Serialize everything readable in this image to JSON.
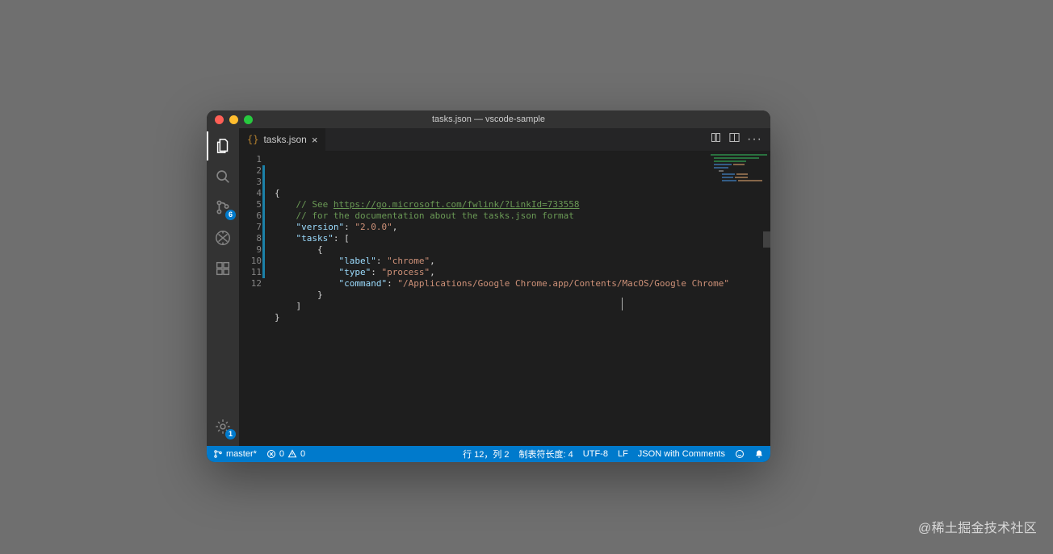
{
  "window": {
    "title": "tasks.json — vscode-sample"
  },
  "tab": {
    "filename": "tasks.json",
    "file_icon": "{}",
    "close_label": "×"
  },
  "activity": {
    "scm_badge": "6",
    "settings_badge": "1"
  },
  "code": {
    "lines": [
      {
        "n": 1,
        "indent": 0,
        "type": "punc",
        "text": "{"
      },
      {
        "n": 2,
        "indent": 1,
        "type": "comment_link",
        "prefix": "// See ",
        "link": "https://go.microsoft.com/fwlink/?LinkId=733558"
      },
      {
        "n": 3,
        "indent": 1,
        "type": "comment",
        "text": "// for the documentation about the tasks.json format"
      },
      {
        "n": 4,
        "indent": 1,
        "type": "kv",
        "key": "version",
        "val": "2.0.0",
        "trail": ","
      },
      {
        "n": 5,
        "indent": 1,
        "type": "kv_open",
        "key": "tasks",
        "open": "["
      },
      {
        "n": 6,
        "indent": 2,
        "type": "punc",
        "text": "{"
      },
      {
        "n": 7,
        "indent": 3,
        "type": "kv",
        "key": "label",
        "val": "chrome",
        "trail": ","
      },
      {
        "n": 8,
        "indent": 3,
        "type": "kv",
        "key": "type",
        "val": "process",
        "trail": ","
      },
      {
        "n": 9,
        "indent": 3,
        "type": "kv",
        "key": "command",
        "val": "/Applications/Google Chrome.app/Contents/MacOS/Google Chrome",
        "trail": ""
      },
      {
        "n": 10,
        "indent": 2,
        "type": "punc",
        "text": "}"
      },
      {
        "n": 11,
        "indent": 1,
        "type": "punc",
        "text": "]"
      },
      {
        "n": 12,
        "indent": 0,
        "type": "punc",
        "text": "}"
      }
    ]
  },
  "status": {
    "branch": "master*",
    "errors": "0",
    "warnings": "0",
    "cursor": "行 12，列 2",
    "tab_size": "制表符长度: 4",
    "encoding": "UTF-8",
    "eol": "LF",
    "language": "JSON with Comments"
  },
  "watermark": "@稀土掘金技术社区"
}
